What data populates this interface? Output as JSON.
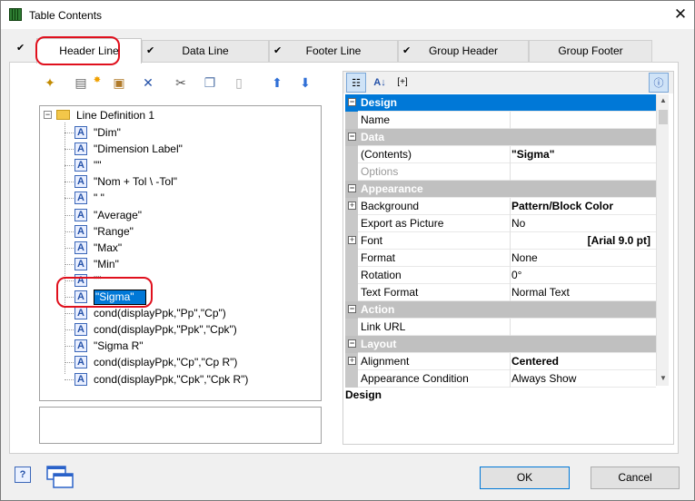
{
  "window": {
    "title": "Table Contents",
    "close": "✕"
  },
  "tabs": [
    {
      "label": "Header Line",
      "checked": true
    },
    {
      "label": "Data Line",
      "checked": true
    },
    {
      "label": "Footer Line",
      "checked": true
    },
    {
      "label": "Group Header",
      "checked": true
    },
    {
      "label": "Group Footer",
      "checked": false
    }
  ],
  "toolbar_icons": [
    "wand-icon",
    "insert-icon",
    "properties-icon",
    "delete-icon",
    "cut-icon",
    "copy-icon",
    "paste-icon",
    "move-up-icon",
    "move-down-icon"
  ],
  "tree": {
    "root": "Line Definition  1",
    "items": [
      "\"Dim\"",
      "\"Dimension Label\"",
      "\"\"",
      "\"Nom   + Tol \\ -Tol\"",
      "\" \"",
      "\"Average\"",
      "\"Range\"",
      "\"Max\"",
      "\"Min\"",
      "\"\"",
      "\"Sigma\"",
      "cond(displayPpk,\"Pp\",\"Cp\")",
      "cond(displayPpk,\"Ppk\",\"Cpk\")",
      "\"Sigma R\"",
      "cond(displayPpk,\"Cp\",\"Cp R\")",
      "cond(displayPpk,\"Cpk\",\"Cpk R\")"
    ],
    "selected_index": 10
  },
  "properties": {
    "rows": [
      {
        "type": "category",
        "label": "Design"
      },
      {
        "type": "prop",
        "name": "Name",
        "value": ""
      },
      {
        "type": "category",
        "label": "Data"
      },
      {
        "type": "prop",
        "name": "(Contents)",
        "value": "\"Sigma\"",
        "bold": true
      },
      {
        "type": "prop",
        "name": "Options",
        "value": "",
        "disabled": true
      },
      {
        "type": "category",
        "label": "Appearance"
      },
      {
        "type": "prop",
        "name": "Background",
        "value": "Pattern/Block Color",
        "bold": true,
        "expand": true
      },
      {
        "type": "prop",
        "name": "Export as Picture",
        "value": "No"
      },
      {
        "type": "prop",
        "name": "Font",
        "value": "[Arial 9.0 pt]",
        "bold": true,
        "expand": true,
        "right": true
      },
      {
        "type": "prop",
        "name": "Format",
        "value": "None"
      },
      {
        "type": "prop",
        "name": "Rotation",
        "value": "0°"
      },
      {
        "type": "prop",
        "name": "Text Format",
        "value": "Normal Text"
      },
      {
        "type": "category",
        "label": "Action"
      },
      {
        "type": "prop",
        "name": "Link URL",
        "value": ""
      },
      {
        "type": "category",
        "label": "Layout"
      },
      {
        "type": "prop",
        "name": "Alignment",
        "value": "Centered",
        "bold": true,
        "expand": true
      },
      {
        "type": "prop",
        "name": "Appearance Condition",
        "value": "Always Show"
      }
    ],
    "description": "Design"
  },
  "buttons": {
    "ok": "OK",
    "cancel": "Cancel",
    "help": "?"
  }
}
